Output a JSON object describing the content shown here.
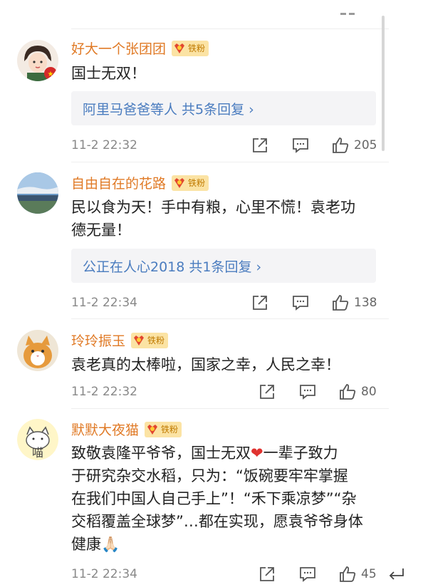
{
  "comments": [
    {
      "username": "好大一个张团团",
      "badge": "铁粉",
      "content": "国士无双！",
      "replies": "阿里马爸爸等人  共5条回复 ›",
      "time": "11-2 22:32",
      "likes": "205"
    },
    {
      "username": "自由自在的花路",
      "badge": "铁粉",
      "content_lines": [
        "民以食为天！手中有粮，心里不慌！袁老功",
        "德无量！"
      ],
      "replies": "公正在人心2018  共1条回复 ›",
      "time": "11-2 22:34",
      "likes": "138"
    },
    {
      "username": "玲玲振玉",
      "badge": "铁粉",
      "content": "袁老真的太棒啦，国家之幸，人民之幸！",
      "time": "11-2 22:32",
      "likes": "80"
    },
    {
      "username": "默默大夜猫",
      "badge": "铁粉",
      "content_lines": [
        "致敬袁隆平爷爷，国士无双",
        "一辈子致力",
        "于研究杂交水稻，只为：“饭碗要牢牢掌握",
        "在我们中国人自己手上”！“禾下乘凉梦”“杂",
        "交稻覆盖全球梦”…都在实现，愿袁爷爷身体",
        "健康🙏🏻"
      ],
      "heart": "❤",
      "time": "11-2 22:34",
      "likes": "45"
    }
  ],
  "icons": [
    "share-icon",
    "comment-icon",
    "like-icon",
    "reply-arrow-icon"
  ],
  "colors": {
    "username": "#e07a26",
    "reply_link": "#4a7cbf",
    "badge_bg": "#fbe3a4",
    "heart": "#e0322f"
  }
}
